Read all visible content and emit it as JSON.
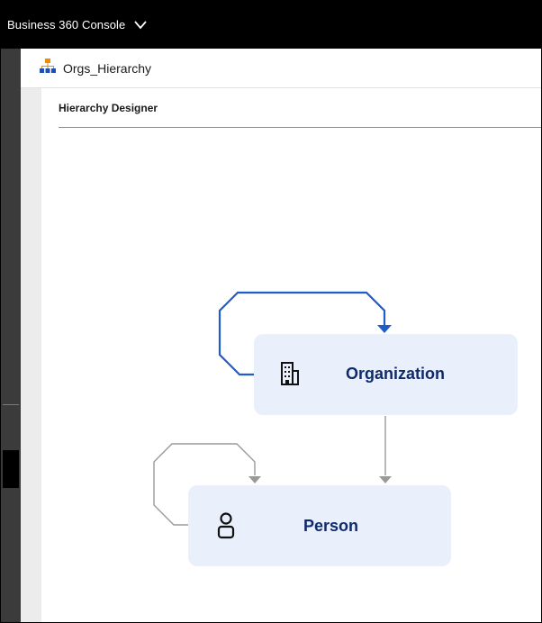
{
  "topbar": {
    "title": "Business 360 Console"
  },
  "org": {
    "name": "Orgs_Hierarchy"
  },
  "designer": {
    "title": "Hierarchy Designer"
  },
  "nodes": {
    "organization": {
      "label": "Organization"
    },
    "person": {
      "label": "Person"
    }
  },
  "colors": {
    "self_link_org": "#1f5ec8",
    "neutral_link": "#9a9a9a",
    "node_fill": "#e9f0fb",
    "node_text": "#0f2a6b"
  },
  "icons": {
    "topbar_chevron": "chevron-down-icon",
    "org_header": "hierarchy-icon",
    "organization_node": "building-icon",
    "person_node": "person-icon"
  }
}
